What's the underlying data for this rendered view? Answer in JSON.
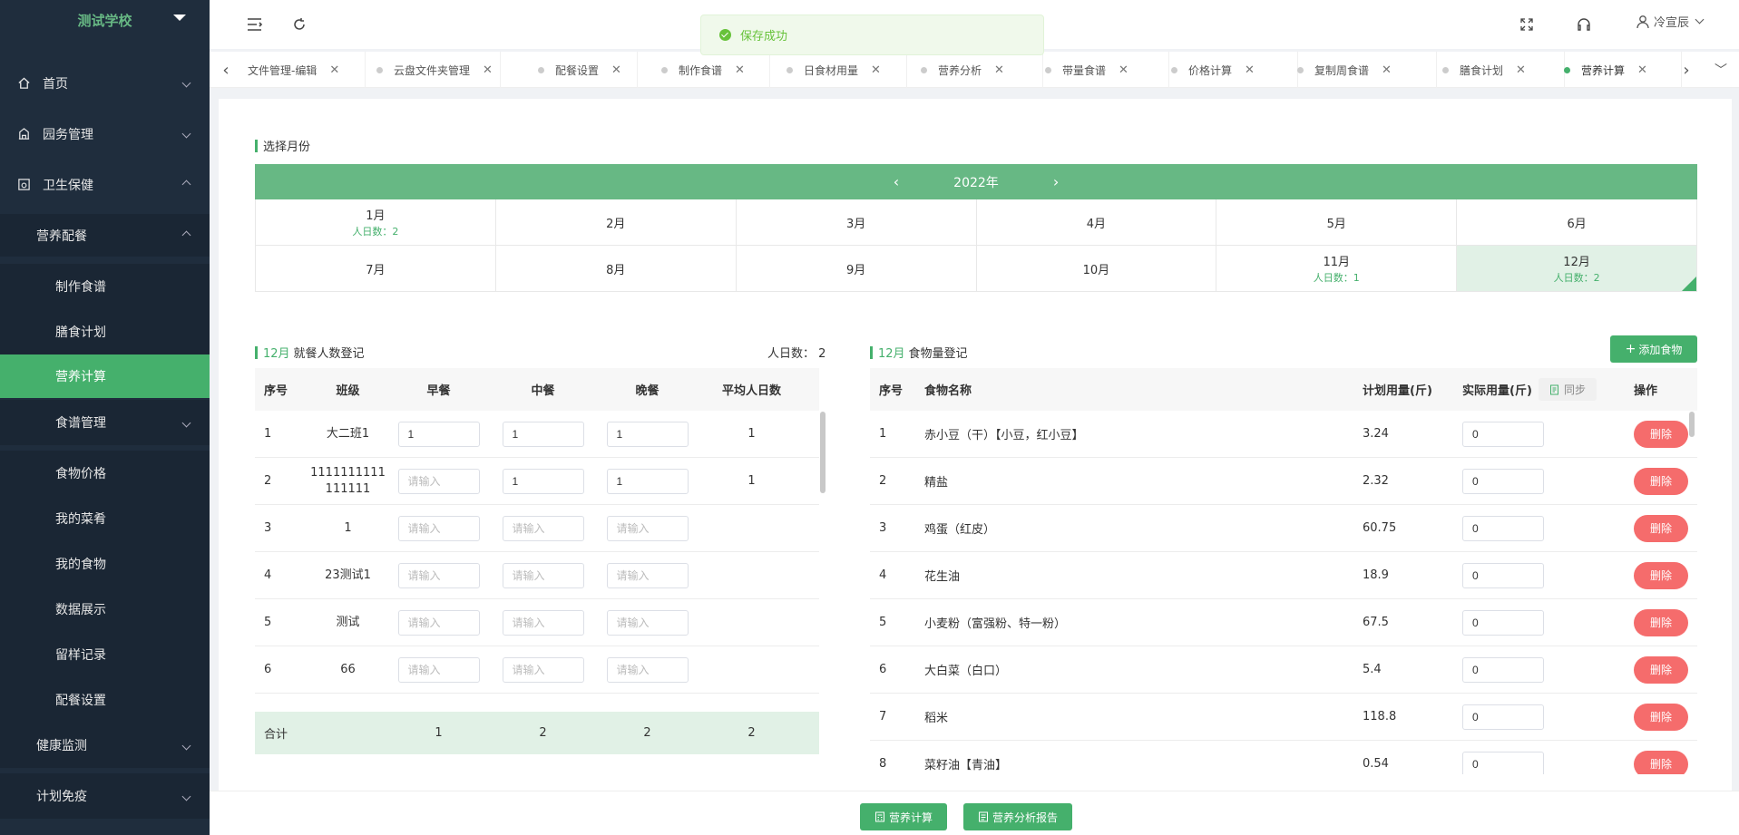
{
  "sidebar": {
    "school": "测试学校",
    "items": [
      {
        "label": "首页",
        "icon": "home-icon"
      },
      {
        "label": "园务管理",
        "icon": "building-icon"
      },
      {
        "label": "卫生保健",
        "icon": "health-icon"
      },
      {
        "label": "营养配餐"
      },
      {
        "label": "制作食谱"
      },
      {
        "label": "膳食计划"
      },
      {
        "label": "营养计算"
      },
      {
        "label": "食谱管理"
      },
      {
        "label": "食物价格"
      },
      {
        "label": "我的菜肴"
      },
      {
        "label": "我的食物"
      },
      {
        "label": "数据展示"
      },
      {
        "label": "留样记录"
      },
      {
        "label": "配餐设置"
      },
      {
        "label": "健康监测"
      },
      {
        "label": "计划免疫"
      }
    ]
  },
  "header": {
    "toast": "保存成功",
    "user": "冷宣辰"
  },
  "tabs": [
    "文件管理-编辑",
    "云盘文件夹管理",
    "配餐设置",
    "制作食谱",
    "日食材用量",
    "营养分析",
    "带量食谱",
    "价格计算",
    "复制周食谱",
    "膳食计划",
    "营养计算"
  ],
  "month_section": {
    "title": "选择月份",
    "year": "2022年",
    "months": [
      {
        "label": "1月",
        "count": "人日数：2"
      },
      {
        "label": "2月",
        "count": ""
      },
      {
        "label": "3月",
        "count": ""
      },
      {
        "label": "4月",
        "count": ""
      },
      {
        "label": "5月",
        "count": ""
      },
      {
        "label": "6月",
        "count": ""
      },
      {
        "label": "7月",
        "count": ""
      },
      {
        "label": "8月",
        "count": ""
      },
      {
        "label": "9月",
        "count": ""
      },
      {
        "label": "10月",
        "count": ""
      },
      {
        "label": "11月",
        "count": "人日数：1"
      },
      {
        "label": "12月",
        "count": "人日数：2"
      }
    ]
  },
  "attendance": {
    "month": "12月",
    "title": "就餐人数登记",
    "summary": "人日数：  2",
    "headers": [
      "序号",
      "班级",
      "早餐",
      "中餐",
      "晚餐",
      "平均人日数"
    ],
    "placeholder": "请输入",
    "rows": [
      {
        "no": "1",
        "cls": "大二班1",
        "b": "1",
        "l": "1",
        "d": "1",
        "avg": "1"
      },
      {
        "no": "2",
        "cls": "1111111111111111",
        "b": "",
        "l": "1",
        "d": "1",
        "avg": "1"
      },
      {
        "no": "3",
        "cls": "1",
        "b": "",
        "l": "",
        "d": "",
        "avg": ""
      },
      {
        "no": "4",
        "cls": "23测试1",
        "b": "",
        "l": "",
        "d": "",
        "avg": ""
      },
      {
        "no": "5",
        "cls": "测试",
        "b": "",
        "l": "",
        "d": "",
        "avg": ""
      },
      {
        "no": "6",
        "cls": "66",
        "b": "",
        "l": "",
        "d": "",
        "avg": ""
      }
    ],
    "total": {
      "label": "合计",
      "b": "1",
      "l": "2",
      "d": "2",
      "avg": "2"
    }
  },
  "food": {
    "month": "12月",
    "title": "食物量登记",
    "add_button": "添加食物",
    "sync": "同步",
    "headers": [
      "序号",
      "食物名称",
      "计划用量(斤)",
      "实际用量(斤)",
      "操作"
    ],
    "delete": "删除",
    "rows": [
      {
        "no": "1",
        "name": "赤小豆（干）【小豆，红小豆】",
        "plan": "3.24",
        "actual": "0"
      },
      {
        "no": "2",
        "name": "精盐",
        "plan": "2.32",
        "actual": "0"
      },
      {
        "no": "3",
        "name": "鸡蛋（红皮）",
        "plan": "60.75",
        "actual": "0"
      },
      {
        "no": "4",
        "name": "花生油",
        "plan": "18.9",
        "actual": "0"
      },
      {
        "no": "5",
        "name": "小麦粉（富强粉、特一粉）",
        "plan": "67.5",
        "actual": "0"
      },
      {
        "no": "6",
        "name": "大白菜（白口）",
        "plan": "5.4",
        "actual": "0"
      },
      {
        "no": "7",
        "name": "稻米",
        "plan": "118.8",
        "actual": "0"
      },
      {
        "no": "8",
        "name": "菜籽油【青油】",
        "plan": "0.54",
        "actual": "0"
      }
    ]
  },
  "footer": {
    "calc": "营养计算",
    "report": "营养分析报告"
  },
  "colors": {
    "accent": "#45b06c",
    "sidebar": "#1f2d3d",
    "danger": "#f56c6c"
  }
}
